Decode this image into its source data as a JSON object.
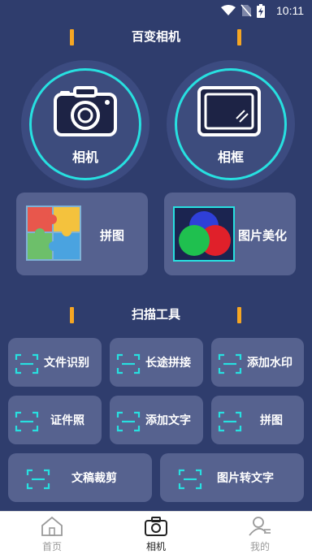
{
  "status_bar": {
    "time": "10:11",
    "icons": [
      "wifi-icon",
      "no-sim-icon",
      "battery-charging-icon"
    ]
  },
  "top_section": {
    "title": "百变相机",
    "accent_color": "#f5a623"
  },
  "circle_buttons": [
    {
      "label": "相机",
      "icon": "camera-icon"
    },
    {
      "label": "相框",
      "icon": "frame-icon"
    }
  ],
  "feature_tiles": [
    {
      "label": "拼图",
      "icon": "puzzle-icon"
    },
    {
      "label": "图片美化",
      "icon": "color-circles-icon"
    }
  ],
  "scan_section": {
    "title": "扫描工具"
  },
  "tools": [
    {
      "label": "文件识别",
      "icon": "scan-icon"
    },
    {
      "label": "长途拼接",
      "icon": "scan-icon"
    },
    {
      "label": "添加水印",
      "icon": "scan-icon"
    },
    {
      "label": "证件照",
      "icon": "scan-icon"
    },
    {
      "label": "添加文字",
      "icon": "scan-icon"
    },
    {
      "label": "拼图",
      "icon": "scan-icon"
    },
    {
      "label": "文稿裁剪",
      "icon": "scan-icon"
    },
    {
      "label": "图片转文字",
      "icon": "scan-icon"
    }
  ],
  "tab_bar": {
    "tabs": [
      {
        "label": "首页",
        "icon": "home-icon",
        "active": false
      },
      {
        "label": "相机",
        "icon": "camera-icon",
        "active": true
      },
      {
        "label": "我的",
        "icon": "profile-icon",
        "active": false
      }
    ],
    "active_color": "#222222",
    "inactive_color": "#9a9a9a"
  },
  "colors": {
    "background": "#2f3d6d",
    "tile": "#56628f",
    "cyan_accent": "#27e0e0"
  }
}
